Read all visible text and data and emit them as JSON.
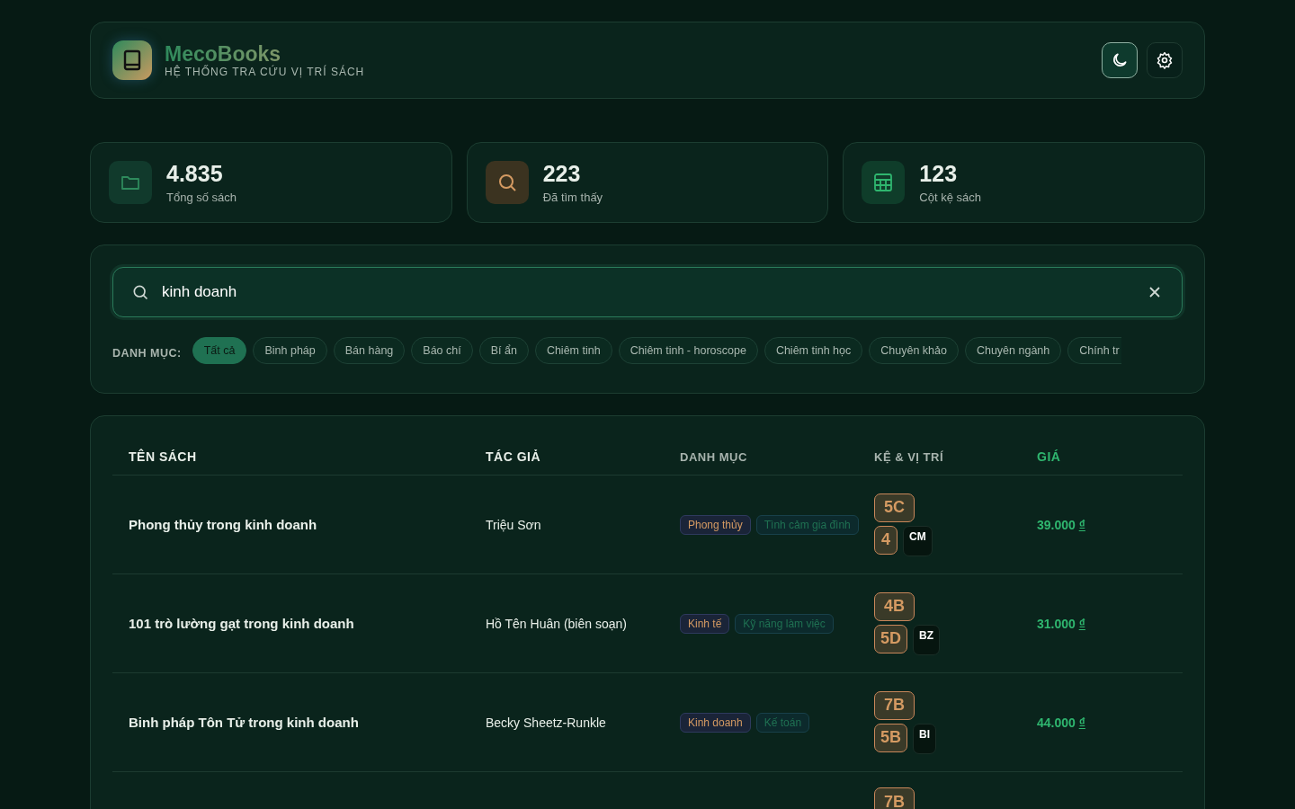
{
  "brand": {
    "name": "MecoBooks",
    "tagline": "HỆ THỐNG TRA CỨU VỊ TRÍ SÁCH"
  },
  "stats": [
    {
      "kind": "folder",
      "value": "4.835",
      "label": "Tổng số sách"
    },
    {
      "kind": "search",
      "value": "223",
      "label": "Đã tìm thấy"
    },
    {
      "kind": "grid",
      "value": "123",
      "label": "Cột kệ sách"
    }
  ],
  "search": {
    "value": "kinh doanh"
  },
  "categories_label": "DANH MỤC:",
  "categories": [
    {
      "label": "Tất cả",
      "selected": true
    },
    {
      "label": "Binh pháp",
      "selected": false
    },
    {
      "label": "Bán hàng",
      "selected": false
    },
    {
      "label": "Báo chí",
      "selected": false
    },
    {
      "label": "Bí ẩn",
      "selected": false
    },
    {
      "label": "Chiêm tinh",
      "selected": false
    },
    {
      "label": "Chiêm tinh - horoscope",
      "selected": false
    },
    {
      "label": "Chiêm tinh học",
      "selected": false
    },
    {
      "label": "Chuyên khảo",
      "selected": false
    },
    {
      "label": "Chuyên ngành",
      "selected": false
    },
    {
      "label": "Chính tr",
      "selected": false
    }
  ],
  "table": {
    "columns": [
      "TÊN SÁCH",
      "TÁC GIẢ",
      "DANH MỤC",
      "KỆ & VỊ TRÍ",
      "GIÁ"
    ],
    "rows": [
      {
        "title": "Phong thủy trong kinh doanh",
        "author": "Triệu Sơn",
        "tags": [
          "Phong thủy",
          "Tình cảm gia đình"
        ],
        "shelf": "5C",
        "slot": "4",
        "code": "CM",
        "price": "39.000",
        "currency": "₫"
      },
      {
        "title": "101 trò lường gạt trong kinh doanh",
        "author": "Hồ Tên Huân (biên soạn)",
        "tags": [
          "Kinh tế",
          "Kỹ năng làm việc"
        ],
        "shelf": "4B",
        "slot": "5D",
        "code": "BZ",
        "price": "31.000",
        "currency": "₫"
      },
      {
        "title": "Binh pháp Tôn Tử trong kinh doanh",
        "author": "Becky Sheetz-Runkle",
        "tags": [
          "Kinh doanh",
          "Kế toán"
        ],
        "shelf": "7B",
        "slot": "5B",
        "code": "BI",
        "price": "44.000",
        "currency": "₫"
      },
      {
        "shelf": "7B"
      }
    ]
  }
}
